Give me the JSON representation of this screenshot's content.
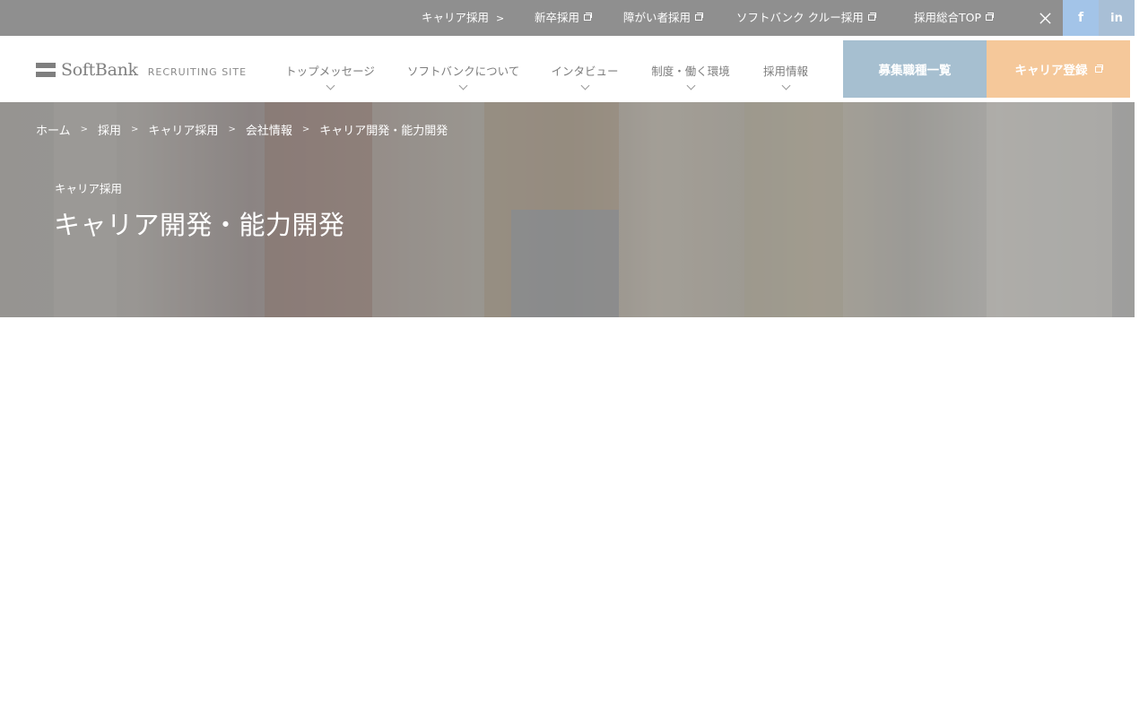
{
  "topbar": {
    "links": [
      {
        "label": "キャリア採用",
        "marker": "chevron"
      },
      {
        "label": "新卒採用",
        "marker": "external"
      },
      {
        "label": "障がい者採用",
        "marker": "external"
      },
      {
        "label": "ソフトバンク クルー採用",
        "marker": "external"
      },
      {
        "label": "採用総合TOP",
        "marker": "external"
      }
    ],
    "social": {
      "x": "𝕏",
      "facebook": "f",
      "linkedin": "in"
    }
  },
  "header": {
    "logo_text": "SoftBank",
    "logo_sub": "RECRUITING SITE",
    "nav": [
      "トップメッセージ",
      "ソフトバンクについて",
      "インタビュー",
      "制度・働く環境",
      "採用情報"
    ],
    "cta_jobs": "募集職種一覧",
    "cta_career": "キャリア登録"
  },
  "breadcrumb": [
    "ホーム",
    "採用",
    "キャリア採用",
    "会社情報",
    "キャリア開発・能力開発"
  ],
  "hero": {
    "kicker": "キャリア採用",
    "title": "キャリア開発・能力開発"
  },
  "colors": {
    "topbar": "#8f8f8f",
    "cta_jobs": "#a6bfd0",
    "cta_career": "#f5c89a",
    "facebook": "#a3c4e8",
    "linkedin": "#a8bfd6"
  }
}
